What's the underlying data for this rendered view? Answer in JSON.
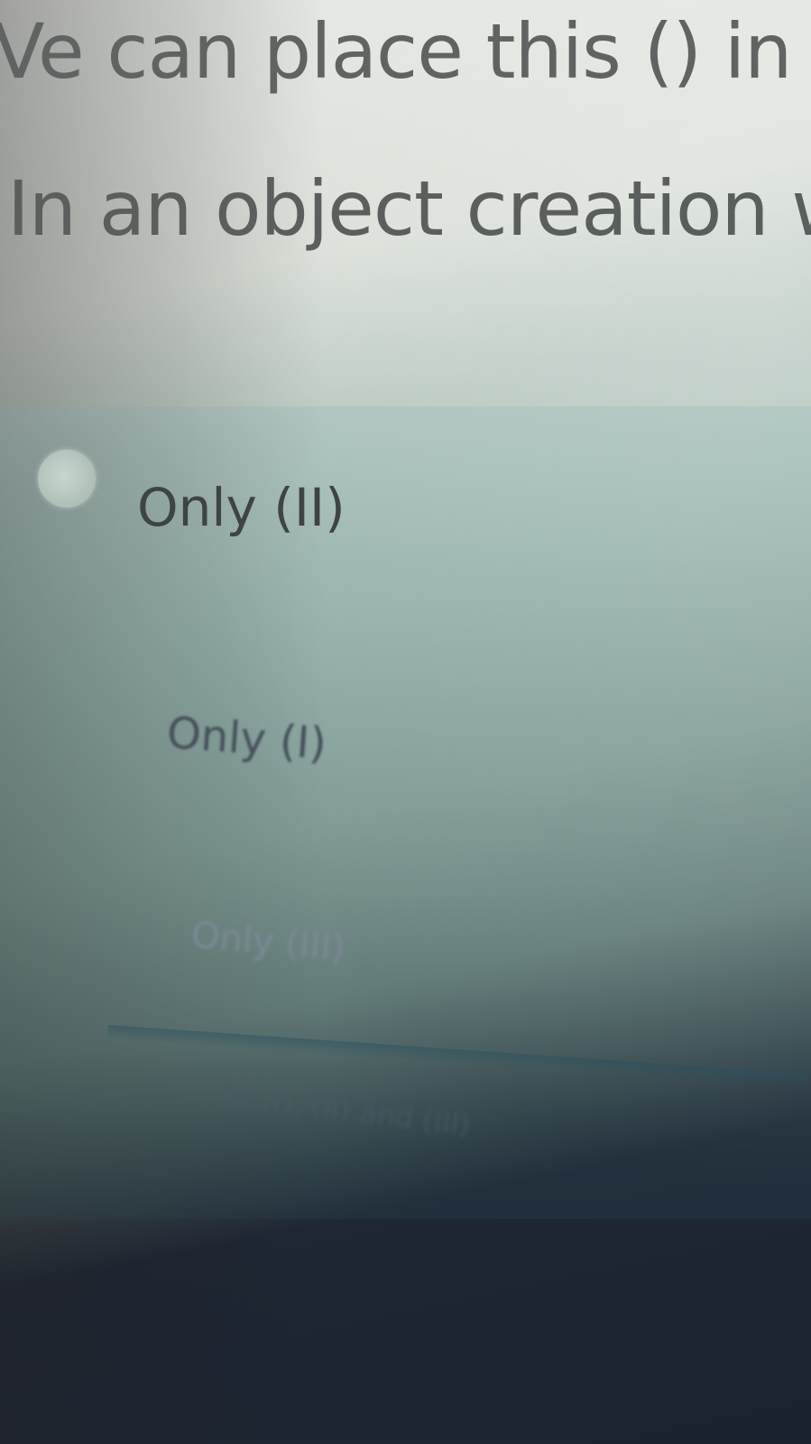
{
  "question": {
    "line1": "Ve can place this () in al",
    "line2": "In an object creation we"
  },
  "options": [
    {
      "label": "Only (II)"
    },
    {
      "label": "Only (I)"
    },
    {
      "label": "Only (III)"
    },
    {
      "label": "All (I), (II) and (III)"
    }
  ],
  "colors": {
    "question_text": "#5f6462",
    "option_text": "#3d4346",
    "panel_tint": "#8fb3ad"
  }
}
